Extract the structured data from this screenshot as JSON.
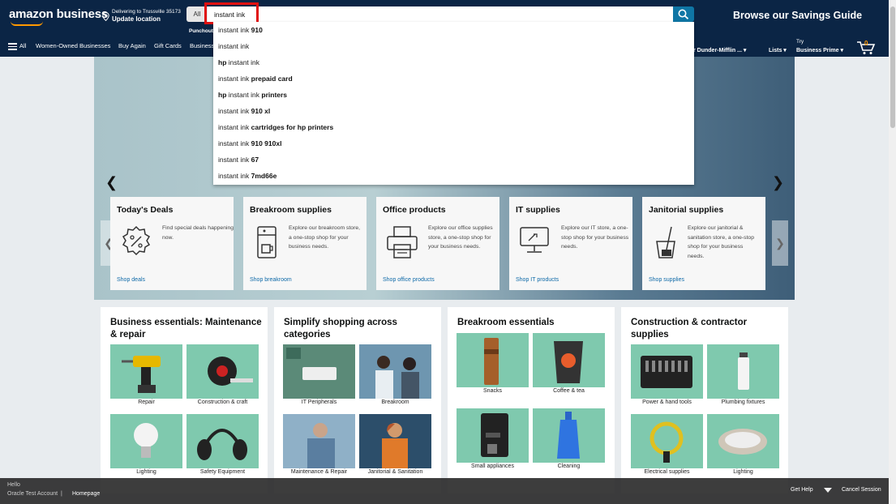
{
  "header": {
    "logo": "amazon business",
    "deliver_line1": "Delivering to Trussville 35173",
    "deliver_line2": "Update location",
    "search_category": "All",
    "search_value": "instant ink",
    "savings_guide": "Browse our Savings Guide",
    "punchout": "Punchout"
  },
  "nav": {
    "all": "All",
    "items": [
      "Women-Owned Businesses",
      "Buy Again",
      "Gift Cards",
      "Business"
    ],
    "account": "r Dunder-Mifflin ...",
    "lists": "Lists",
    "try": "Try",
    "business_prime": "Business Prime",
    "cart_count": "0"
  },
  "suggestions": [
    {
      "prefix": "",
      "base": "instant ink",
      "suffix": " 910"
    },
    {
      "prefix": "",
      "base": "instant ink",
      "suffix": ""
    },
    {
      "prefix": "hp ",
      "base": "instant ink",
      "suffix": ""
    },
    {
      "prefix": "",
      "base": "instant ink",
      "suffix": " prepaid card"
    },
    {
      "prefix": "hp ",
      "base": "instant ink",
      "suffix": " printers"
    },
    {
      "prefix": "",
      "base": "instant ink",
      "suffix": " 910 xl"
    },
    {
      "prefix": "",
      "base": "instant ink",
      "suffix": " cartridges for hp printers"
    },
    {
      "prefix": "",
      "base": "instant ink",
      "suffix": " 910 910xl"
    },
    {
      "prefix": "",
      "base": "instant ink",
      "suffix": " 67"
    },
    {
      "prefix": "",
      "base": "instant ink",
      "suffix": " 7md66e"
    }
  ],
  "categories": [
    {
      "title": "Today's Deals",
      "desc": "Find special deals happening now.",
      "link": "Shop deals",
      "icon": "percent-badge-icon"
    },
    {
      "title": "Breakroom supplies",
      "desc": "Explore our breakroom store, a one-stop shop for your business needs.",
      "link": "Shop breakroom",
      "icon": "coffee-machine-icon"
    },
    {
      "title": "Office products",
      "desc": "Explore our office supplies store, a one-stop shop for your business needs.",
      "link": "Shop office products",
      "icon": "printer-icon"
    },
    {
      "title": "IT supplies",
      "desc": "Explore our IT store, a one-stop shop for your business needs.",
      "link": "Shop IT products",
      "icon": "computer-icon"
    },
    {
      "title": "Janitorial supplies",
      "desc": "Explore our janitorial & sanitation store, a one-stop shop for your business needs.",
      "link": "Shop supplies",
      "icon": "cleaning-bucket-icon"
    }
  ],
  "panels": [
    {
      "title": "Business essentials: Maintenance & repair",
      "tiles": [
        "Repair",
        "Construction & craft",
        "Lighting",
        "Safety Equipment"
      ]
    },
    {
      "title": "Simplify shopping across categories",
      "tiles": [
        "IT Peripherals",
        "Breakroom",
        "Maintenance & Repair",
        "Janitorial & Sanitation"
      ]
    },
    {
      "title": "Breakroom essentials",
      "tiles": [
        "Snacks",
        "Coffee & tea",
        "Small appliances",
        "Cleaning"
      ]
    },
    {
      "title": "Construction & contractor supplies",
      "tiles": [
        "Power & hand tools",
        "Plumbing fixtures",
        "Electrical supplies",
        "Lighting"
      ]
    }
  ],
  "bottom": {
    "hello": "Hello",
    "account": "Oracle Test Account",
    "homepage": "Homepage",
    "get_help": "Get Help",
    "cancel": "Cancel Session"
  },
  "colors": {
    "header_bg": "#0b2545",
    "accent": "#ff9900",
    "link": "#0f6aa8",
    "highlight_box": "#e01010",
    "tile_bg": "#7fc9ae"
  }
}
